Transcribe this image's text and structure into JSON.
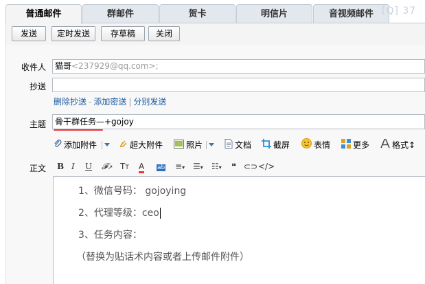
{
  "tabs": [
    {
      "label": "普通邮件"
    },
    {
      "label": "群邮件"
    },
    {
      "label": "贺卡"
    },
    {
      "label": "明信片"
    },
    {
      "label": "音视频邮件"
    }
  ],
  "watermark": "[Q] 37",
  "toolbar": {
    "send": "发送",
    "scheduled_send": "定时发送",
    "save_draft": "存草稿",
    "close": "关闭"
  },
  "recipient": {
    "label": "收件人",
    "name": "猫哥",
    "address": "<237929@qq.com>;"
  },
  "cc": {
    "label": "抄送",
    "value": ""
  },
  "cc_links": {
    "delete_cc": "删除抄送",
    "add_bcc": "添加密送",
    "separate_send": "分别发送",
    "dash": "-",
    "pipe": "|"
  },
  "subject": {
    "label": "主题",
    "value": "骨干群任务—+gojoy"
  },
  "attachments": {
    "add_attachment": "添加附件",
    "large_attachment": "超大附件",
    "photos": "照片",
    "document": "文档",
    "screenshot": "截屏",
    "emoticon": "表情",
    "more": "更多",
    "format": "格式"
  },
  "body": {
    "label": "正文",
    "lines": [
      "1、微信号码： gojoying",
      "2、代理等级：ceo",
      "3、任务内容：",
      "（替换为贴话术内容或者上传邮件附件）"
    ]
  },
  "icons": {
    "paperclip": "paperclip-icon",
    "large_attachment": "large-attachment-icon",
    "photo": "photo-icon",
    "document": "document-icon",
    "screenshot": "screenshot-icon",
    "emoticon": "emoticon-icon",
    "more": "more-icon",
    "format": "format-icon"
  },
  "colors": {
    "accent_red": "#e33333",
    "link_blue": "#1a5aa0",
    "tab_bg": "#e3e8ee"
  }
}
